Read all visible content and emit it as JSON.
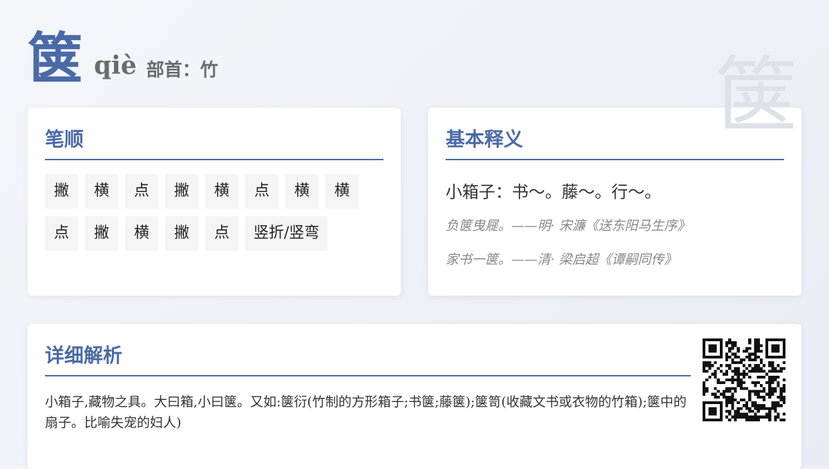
{
  "header": {
    "character": "箧",
    "pinyin": "qiè",
    "radical": "部首：竹"
  },
  "watermark": "箧",
  "strokes_card": {
    "title": "笔顺",
    "strokes": [
      "撇",
      "横",
      "点",
      "撇",
      "横",
      "点",
      "横",
      "横",
      "点",
      "撇",
      "横",
      "撇",
      "点",
      "竖折/竖弯"
    ]
  },
  "basic_card": {
    "title": "基本释义",
    "definition": "小箱子：书～。藤～。行～。",
    "examples": [
      "负箧曳屣。——明· 宋濂《送东阳马生序》",
      "家书一箧。——清· 梁启超《谭嗣同传》"
    ]
  },
  "detail_card": {
    "title": "详细解析",
    "text": "小箱子,藏物之具。大曰箱,小曰箧。又如:箧衍(竹制的方形箱子;书箧;藤箧);箧笥(收藏文书或衣物的竹箱);箧中的扇子。比喻失宠的妇人)",
    "qr_icon": "qr-code"
  },
  "colors": {
    "accent": "#4a6aa8",
    "muted": "#6b6b6b",
    "example": "#888888"
  }
}
